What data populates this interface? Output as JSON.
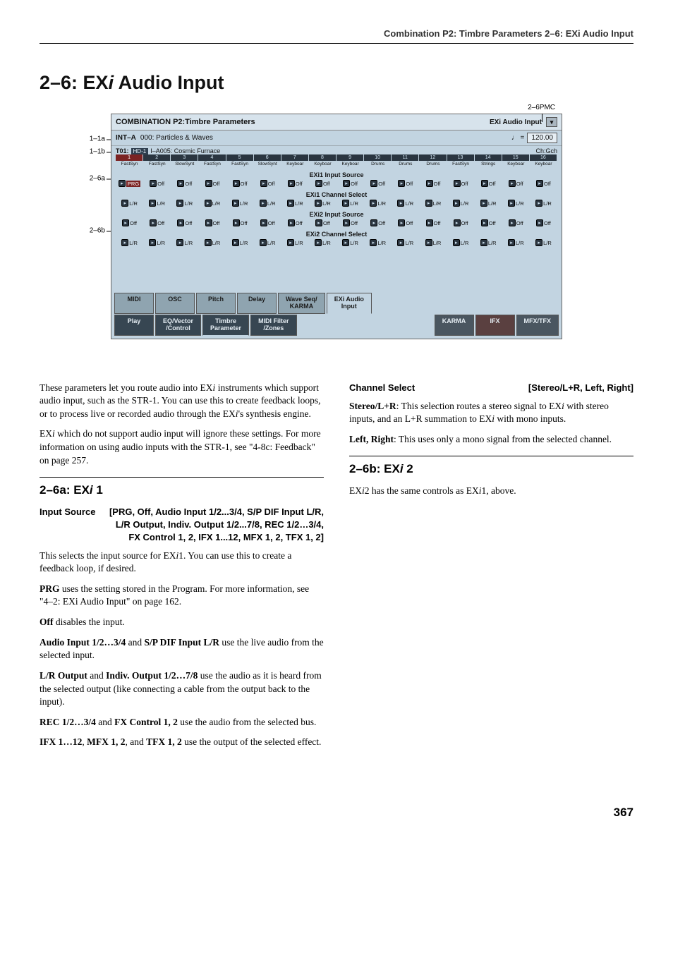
{
  "header": {
    "text": "Combination P2: Timbre Parameters    2–6: EXi Audio Input"
  },
  "title": {
    "pre": "2–6: EX",
    "italic": "i",
    "post": " Audio Input"
  },
  "callouts": {
    "top": "2–6PMC",
    "left": {
      "a1": "1–1a",
      "b1": "1–1b",
      "a2": "2–6a",
      "b2": "2–6b"
    }
  },
  "screen": {
    "page": "COMBINATION P2:Timbre Parameters",
    "section": "EXi Audio Input",
    "bank": "INT–A",
    "prog": "000: Particles & Waves",
    "tempoLabel": "♩ =",
    "tempo": "120.00",
    "timbre": "T01:",
    "hd3": "HD-1",
    "timbreProg": "I–A005: Cosmic Furnace",
    "ch": "Ch:Gch",
    "nums": [
      "1",
      "2",
      "3",
      "4",
      "5",
      "6",
      "7",
      "8",
      "9",
      "10",
      "11",
      "12",
      "13",
      "14",
      "15",
      "16"
    ],
    "tracks": [
      "FastSyn",
      "FastSyn",
      "SlowSynt",
      "FastSyn",
      "FastSyn",
      "SlowSynt",
      "Keyboar",
      "Keyboar",
      "Keyboar",
      "Drums",
      "Drums",
      "Drums",
      "FastSyn",
      "Strings",
      "Keyboar",
      "Keyboar"
    ],
    "panels": [
      {
        "title": "EXi1 Input Source",
        "vals": [
          "PRG",
          "Off",
          "Off",
          "Off",
          "Off",
          "Off",
          "Off",
          "Off",
          "Off",
          "Off",
          "Off",
          "Off",
          "Off",
          "Off",
          "Off",
          "Off"
        ],
        "first": true
      },
      {
        "title": "EXi1 Channel Select",
        "vals": [
          "L/R",
          "L/R",
          "L/R",
          "L/R",
          "L/R",
          "L/R",
          "L/R",
          "L/R",
          "L/R",
          "L/R",
          "L/R",
          "L/R",
          "L/R",
          "L/R",
          "L/R",
          "L/R"
        ]
      },
      {
        "title": "EXi2 Input Source",
        "vals": [
          "Off",
          "Off",
          "Off",
          "Off",
          "Off",
          "Off",
          "Off",
          "Off",
          "Off",
          "Off",
          "Off",
          "Off",
          "Off",
          "Off",
          "Off",
          "Off"
        ]
      },
      {
        "title": "EXi2 Channel Select",
        "vals": [
          "L/R",
          "L/R",
          "L/R",
          "L/R",
          "L/R",
          "L/R",
          "L/R",
          "L/R",
          "L/R",
          "L/R",
          "L/R",
          "L/R",
          "L/R",
          "L/R",
          "L/R",
          "L/R"
        ]
      }
    ],
    "uppertabs": [
      "MIDI",
      "OSC",
      "Pitch",
      "Delay",
      "Wave Seq/\nKARMA",
      "EXi Audio\nInput"
    ],
    "uppertabs_active": 5,
    "lowertabs": [
      {
        "t": "Play",
        "cls": "dark"
      },
      {
        "t": "EQ/Vector\n/Control",
        "cls": "dark"
      },
      {
        "t": "Timbre\nParameter",
        "cls": "dark active"
      },
      {
        "t": "MIDI Filter\n/Zones",
        "cls": "dark"
      },
      {
        "t": "",
        "cls": "spacer"
      },
      {
        "t": "KARMA",
        "cls": "dark k"
      },
      {
        "t": "IFX",
        "cls": "dark f"
      },
      {
        "t": "MFX/TFX",
        "cls": "dark m"
      }
    ]
  },
  "body": {
    "leftcol": {
      "p1a": "These parameters let you route audio into EX",
      "p1b": " instruments which support audio input, such as the STR-1. You can use this to create feedback loops, or to process live or recorded audio through the EX",
      "p1c": "'s synthesis engine.",
      "p2a": "EX",
      "p2b": " which do not support audio input will ignore these settings. For more information on using audio inputs with the STR-1, see \"4-8c: Feedback\" on page 257.",
      "h2": {
        "pre": "2–6a: EX",
        "italic": "i",
        "post": " 1"
      },
      "field1": {
        "label": "Input Source",
        "opts": "[PRG, Off, Audio Input 1/2...3/4, S/P DIF Input L/R, L/R Output, Indiv. Output 1/2...7/8, REC 1/2…3/4, FX Control 1, 2, IFX 1...12, MFX 1, 2, TFX 1, 2]"
      },
      "f1pa": "This selects the input source for EX",
      "f1pb": "1. You can use this to create a feedback loop, if desired.",
      "f2a": "PRG",
      "f2b": " uses the setting stored in the Program. For more information, see \"4–2: EXi Audio Input\" on page 162.",
      "f3a": "Off",
      "f3b": " disables the input.",
      "f4a": "Audio Input 1/2…3/4",
      "f4b": " and ",
      "f4c": "S/P DIF Input L/R",
      "f4d": " use the live audio from the selected input.",
      "f5a": "L/R Output",
      "f5b": " and ",
      "f5c": "Indiv. Output 1/2…7/8",
      "f5d": " use the audio as it is heard from the selected output (like connecting a cable from the output back to the input).",
      "f6a": "REC 1/2…3/4",
      "f6b": " and ",
      "f6c": "FX Control 1, 2",
      "f6d": " use the audio from the selected bus.",
      "f7a": "IFX 1…12",
      "f7b": ", ",
      "f7c": "MFX 1, 2",
      "f7d": ", and ",
      "f7e": "TFX 1, 2",
      "f7f": " use the output of the selected effect."
    },
    "rightcol": {
      "field2": {
        "label": "Channel Select",
        "opts": "[Stereo/L+R, Left, Right]"
      },
      "r1a": "Stereo/L+R",
      "r1b": ": This selection routes a stereo signal to EX",
      "r1c": " with stereo inputs, and an L+R summation to EX",
      "r1d": " with mono inputs.",
      "r2a": "Left, Right",
      "r2b": ": This uses only a mono signal from the selected channel.",
      "h2": {
        "pre": "2–6b: EX",
        "italic": "i",
        "post": " 2"
      },
      "r3a": "EX",
      "r3b": "2 has the same controls as EX",
      "r3c": "1, above."
    }
  },
  "pagenum": "367"
}
